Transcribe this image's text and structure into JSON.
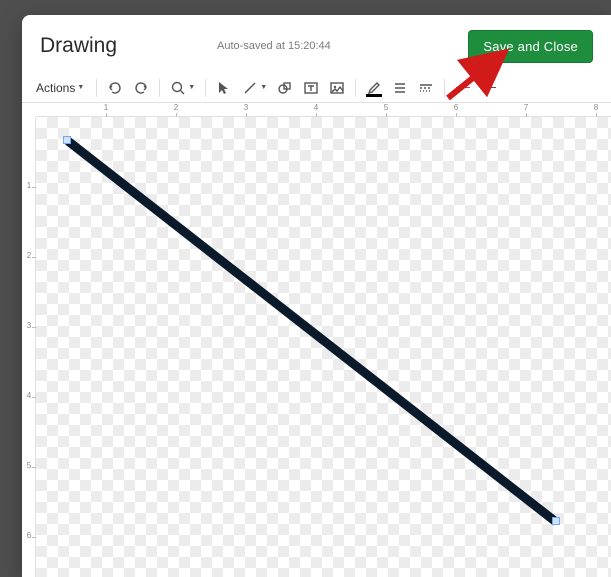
{
  "header": {
    "title": "Drawing",
    "autosave": "Auto-saved at 15:20:44",
    "save_btn": "Save and Close"
  },
  "toolbar": {
    "actions": "Actions"
  },
  "ruler": {
    "h": [
      "1",
      "2",
      "3",
      "4",
      "5",
      "6",
      "7",
      "8"
    ],
    "v": [
      "1",
      "2",
      "3",
      "4",
      "5",
      "6"
    ]
  },
  "colors": {
    "save_btn_bg": "#1e8e3e",
    "arrow": "#d11a1a"
  }
}
